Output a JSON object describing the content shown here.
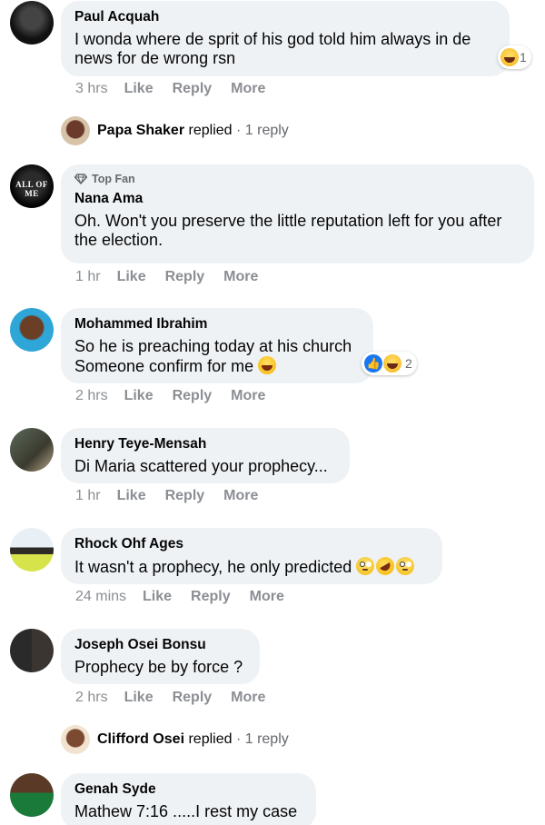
{
  "comments": [
    {
      "author": "Paul Acquah",
      "text_lines": [
        "I wonda where de sprit of his god told him always in de",
        "news for de wrong rsn"
      ],
      "time": "3 hrs",
      "reaction_count": "1",
      "replied_by": "Papa Shaker",
      "replied_text": "replied",
      "reply_count": "· 1 reply"
    },
    {
      "author": "Nana Ama",
      "badge": "Top Fan",
      "avatar_text": "ALL OF ME",
      "text_lines": [
        "Oh. Won't you preserve the little reputation left for you after",
        "the election."
      ],
      "time": "1 hr"
    },
    {
      "author": "Mohammed Ibrahim",
      "text_lines": [
        "So he is preaching today at his church",
        "Someone confirm for me"
      ],
      "time": "2 hrs",
      "reaction_count": "2"
    },
    {
      "author": "Henry Teye-Mensah",
      "text_lines": [
        "Di Maria scattered your prophecy..."
      ],
      "time": "1 hr"
    },
    {
      "author": "Rhock Ohf Ages",
      "text_lines": [
        "It wasn't a prophecy, he only predicted"
      ],
      "time": "24 mins"
    },
    {
      "author": "Joseph Osei Bonsu",
      "text_lines": [
        "Prophecy be by force ?"
      ],
      "time": "2 hrs",
      "replied_by": "Clifford Osei",
      "replied_text": "replied",
      "reply_count": "· 1 reply"
    },
    {
      "author": "Genah Syde",
      "text_lines": [
        "Mathew 7:16 .....I rest my case"
      ]
    }
  ],
  "actions": {
    "like": "Like",
    "reply": "Reply",
    "more": "More"
  },
  "icons": {
    "topfan": "diamond-icon",
    "reaction_like": "like-reaction-icon",
    "reaction_haha": "haha-reaction-icon"
  },
  "colors": {
    "bubble": "#eff2f5",
    "meta": "#8b8e93",
    "like_blue": "#1877f2"
  }
}
